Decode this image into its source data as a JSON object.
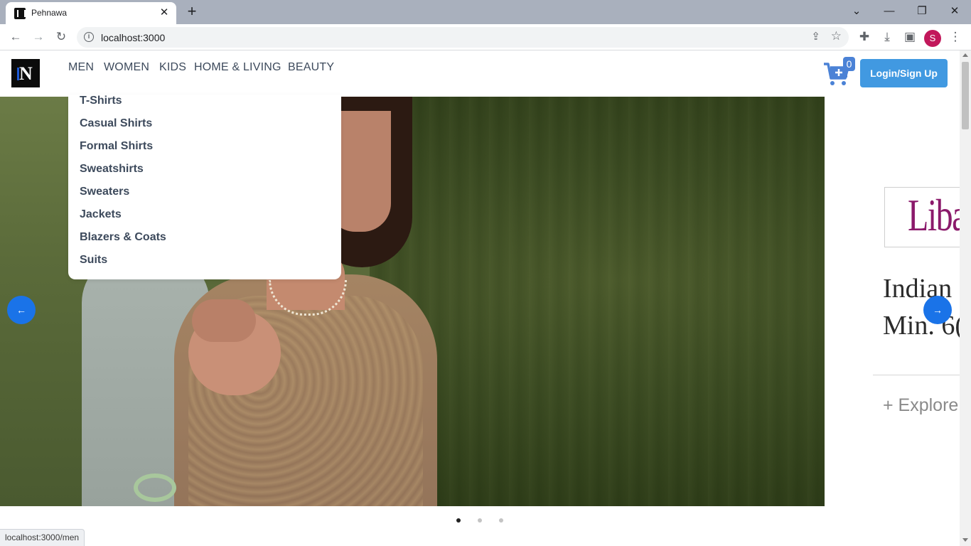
{
  "browser": {
    "tab_title": "Pehnawa",
    "url": "localhost:3000",
    "status_url": "localhost:3000/men",
    "profile_initial": "S"
  },
  "navbar": {
    "items": [
      {
        "label": "MEN"
      },
      {
        "label": "WOMEN"
      },
      {
        "label": "KIDS"
      },
      {
        "label": "HOME & LIVING"
      },
      {
        "label": "BEAUTY"
      }
    ],
    "cart_count": "0",
    "login_label": "Login/Sign Up"
  },
  "dropdown": {
    "items": [
      {
        "label": "T-Shirts"
      },
      {
        "label": "Casual Shirts"
      },
      {
        "label": "Formal Shirts"
      },
      {
        "label": "Sweatshirts"
      },
      {
        "label": "Sweaters"
      },
      {
        "label": "Jackets"
      },
      {
        "label": "Blazers & Coats"
      },
      {
        "label": "Suits"
      }
    ]
  },
  "carousel": {
    "side_brand": "Liba",
    "side_line1": "Indian",
    "side_line2": "Min. 6(",
    "side_explore": "+ Explore",
    "active_slide": 1,
    "slide_count": 3
  },
  "colors": {
    "accent": "#4199e1",
    "arrow": "#1a73e8",
    "nav_text": "#3d4a5c",
    "brand": "#8b1a6b"
  }
}
